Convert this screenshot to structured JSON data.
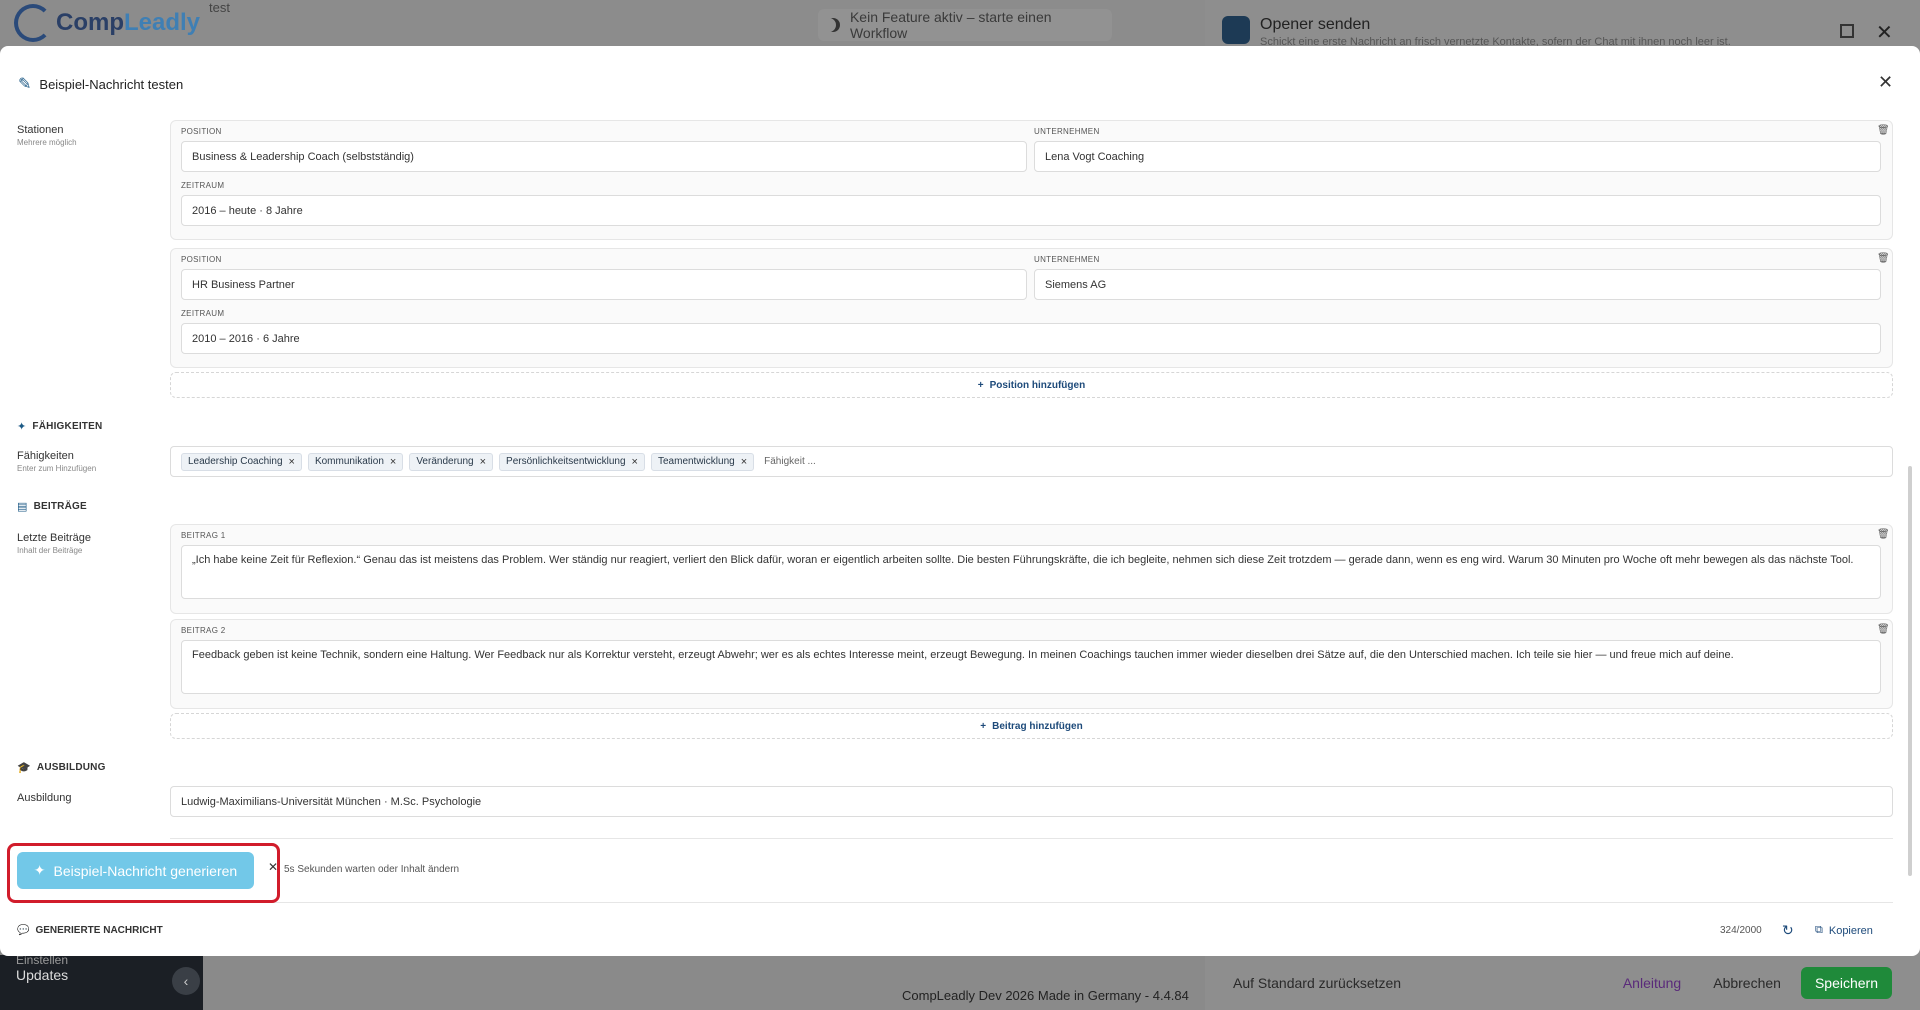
{
  "bg": {
    "logo_prefix": "Comp",
    "logo_suffix": "Leadly",
    "test_text": "test",
    "feature_status": "Kein Feature aktiv – starte einen Workflow",
    "right_panel_title": "Opener senden",
    "right_panel_sub": "Schickt eine erste Nachricht an frisch vernetzte Kontakte, sofern der Chat mit ihnen noch leer ist.",
    "footer_reset": "Auf Standard zurücksetzen",
    "footer_guide": "Anleitung",
    "footer_cancel": "Abbrechen",
    "footer_save": "Speichern",
    "sidebar_updates": "Updates",
    "sidebar_prev": "Einstellen",
    "bottom_text": "CompLeadly Dev   2026 Made in Germany - 4.4.84"
  },
  "modal": {
    "title": "Beispiel-Nachricht testen",
    "stations_label": "Stationen",
    "stations_sub": "Mehrere möglich",
    "position_cap": "POSITION",
    "company_cap": "UNTERNEHMEN",
    "period_cap": "ZEITRAUM",
    "stations": [
      {
        "position": "Business & Leadership Coach (selbstständig)",
        "company": "Lena Vogt Coaching",
        "period": "2016 – heute · 8 Jahre"
      },
      {
        "position": "HR Business Partner",
        "company": "Siemens AG",
        "period": "2010 – 2016 · 6 Jahre"
      }
    ],
    "add_position": "Position hinzufügen",
    "skills_section": "FÄHIGKEITEN",
    "skills_label": "Fähigkeiten",
    "skills_sub": "Enter zum Hinzufügen",
    "skills": [
      "Leadership Coaching",
      "Kommunikation",
      "Veränderung",
      "Persönlichkeitsentwicklung",
      "Teamentwicklung"
    ],
    "skills_placeholder": "Fähigkeit ...",
    "posts_section": "BEITRÄGE",
    "posts_label": "Letzte Beiträge",
    "posts_sub": "Inhalt der Beiträge",
    "posts": [
      {
        "cap": "BEITRAG 1",
        "text": "„Ich habe keine Zeit für Reflexion.“ Genau das ist meistens das Problem. Wer ständig nur reagiert, verliert den Blick dafür, woran er eigentlich arbeiten sollte. Die besten Führungskräfte, die ich begleite, nehmen sich diese Zeit trotzdem — gerade dann, wenn es eng wird. Warum 30 Minuten pro Woche oft mehr bewegen als das nächste Tool."
      },
      {
        "cap": "BEITRAG 2",
        "text": "Feedback geben ist keine Technik, sondern eine Haltung. Wer Feedback nur als Korrektur versteht, erzeugt Abwehr; wer es als echtes Interesse meint, erzeugt Bewegung. In meinen Coachings tauchen immer wieder dieselben drei Sätze auf, die den Unterschied machen. Ich teile sie hier — und freue mich auf deine."
      }
    ],
    "add_post": "Beitrag hinzufügen",
    "education_section": "AUSBILDUNG",
    "education_label": "Ausbildung",
    "education_value": "Ludwig-Maximilians-Universität München · M.Sc. Psychologie",
    "generate_button": "Beispiel-Nachricht generieren",
    "generate_note": "5s Sekunden warten oder Inhalt ändern",
    "generated_section": "GENERIERTE NACHRICHT",
    "counter": "324/2000",
    "copy_label": "Kopieren"
  }
}
